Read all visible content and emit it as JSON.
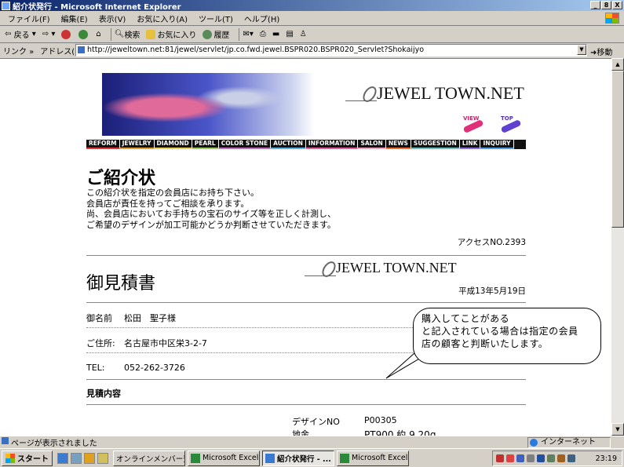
{
  "window": {
    "title": "紹介状発行 - Microsoft Internet Explorer",
    "buttons": [
      "_",
      "8",
      "X"
    ]
  },
  "menubar": {
    "items": [
      "ファイル(F)",
      "編集(E)",
      "表示(V)",
      "お気に入り(A)",
      "ツール(T)",
      "ヘルプ(H)"
    ]
  },
  "toolbar": {
    "back": "戻る",
    "search": "検索",
    "favorites": "お気に入り",
    "history": "履歴"
  },
  "addressbar": {
    "links_label": "リンク »",
    "address_label": "アドレス(D)",
    "url": "http://jeweltown.net:81/jewel/servlet/jp.co.fwd.jewel.BSPR020.BSPR020_Servlet?Shokaijyo",
    "go_label": "移動"
  },
  "page": {
    "logo_text": "JEWEL TOWN.NET",
    "view_label": "VIEW",
    "top_label": "TOP",
    "nav": [
      {
        "label": "REFORM",
        "color": "#e03a3a"
      },
      {
        "label": "JEWELRY",
        "color": "#e0a030"
      },
      {
        "label": "DIAMOND",
        "color": "#e8d050"
      },
      {
        "label": "PEARL",
        "color": "#a0c860"
      },
      {
        "label": "COLOR STONE",
        "color": "#c070c0"
      },
      {
        "label": "AUCTION",
        "color": "#60b0e0"
      },
      {
        "label": "INFORMATION",
        "color": "#e060a0"
      },
      {
        "label": "SALON",
        "color": "#f0a0c0"
      },
      {
        "label": "NEWS",
        "color": "#f07030"
      },
      {
        "label": "SUGGESTION",
        "color": "#70c0c0"
      },
      {
        "label": "LINK",
        "color": "#9070d0"
      },
      {
        "label": "INQUIRY",
        "color": "#50a0e0"
      }
    ],
    "heading": "ご紹介状",
    "intro_lines": [
      "この紹介状を指定の会員店にお持ち下さい。",
      "会員店が責任を持ってご相談を承ります。",
      "尚、会員店においてお手持ちの宝石のサイズ等を正しく計測し、",
      "ご希望のデザインが加工可能かどうか判断させていただきます。"
    ],
    "access": "アクセスNO.2393",
    "estimate_title": "御見積書",
    "logo2_text": "JEWEL TOWN.NET",
    "date": "平成13年5月19日",
    "fields": {
      "name_label": "御名前",
      "name_value": "松田　聖子様",
      "address_label": "ご住所:",
      "address_value": "名古屋市中区栄3-2-7",
      "tel_label": "TEL:",
      "tel_value": "052-262-3726"
    },
    "section_title": "見積内容",
    "details": [
      {
        "label": "デザインNO",
        "value": "P00305"
      },
      {
        "label": "地金",
        "value": "PT900 約 9.20g"
      }
    ]
  },
  "callout": {
    "lines": [
      "購入してことがある",
      "と記入されている場合は指定の会員",
      "店の顧客と判断いたします。"
    ]
  },
  "statusbar": {
    "text": "ページが表示されました",
    "zone": "インターネット"
  },
  "taskbar": {
    "start": "スタート",
    "tasks": [
      {
        "label": "オンラインメンバー登録",
        "active": false
      },
      {
        "label": "Microsoft Excel",
        "active": false
      },
      {
        "label": "紹介状発行 - ...",
        "active": true
      },
      {
        "label": "Microsoft Excel",
        "active": false
      }
    ],
    "clock": "23:19"
  }
}
